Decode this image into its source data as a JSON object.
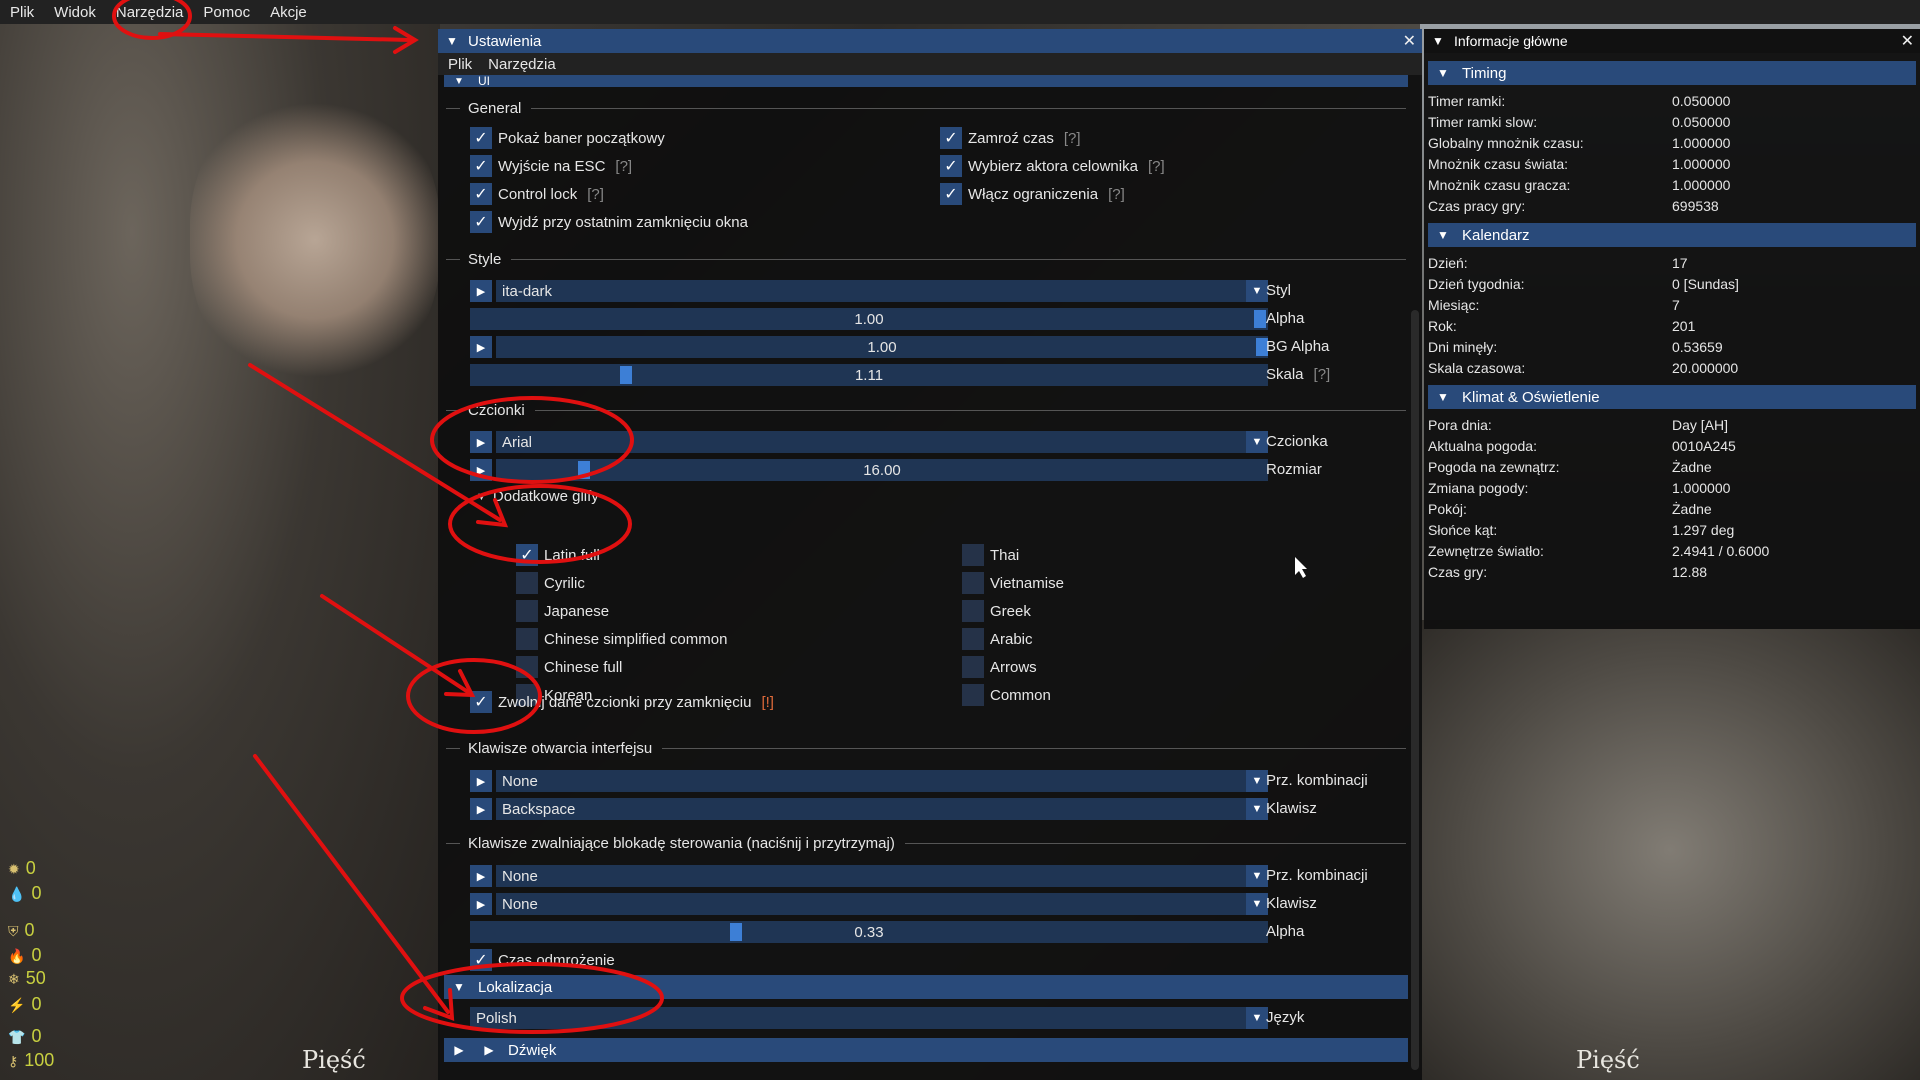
{
  "menubar": [
    "Plik",
    "Widok",
    "Narzędzia",
    "Pomoc",
    "Akcje"
  ],
  "settings": {
    "title": "Ustawienia",
    "submenu": [
      "Plik",
      "Narzędzia"
    ],
    "ui_label": "UI",
    "general": {
      "label": "General",
      "left": [
        "Pokaż baner początkowy",
        "Wyjście na ESC",
        "Control lock",
        "Wyjdź przy ostatnim zamknięciu okna"
      ],
      "right": [
        "Zamroź czas",
        "Wybierz aktora celownika",
        "Włącz ograniczenia"
      ],
      "help": "[?]"
    },
    "style": {
      "label": "Style",
      "theme": "ita-dark",
      "theme_label": "Styl",
      "alpha": "1.00",
      "alpha_label": "Alpha",
      "bg_alpha": "1.00",
      "bg_alpha_label": "BG Alpha",
      "scale": "1.11",
      "scale_label": "Skala",
      "alpha_fraction": 1.0,
      "bg_alpha_fraction": 1.0,
      "scale_fraction": 0.2
    },
    "fonts": {
      "label": "Czcionki",
      "font": "Arial",
      "font_label": "Czcionka",
      "size": "16.00",
      "size_label": "Rozmiar",
      "size_fraction": 0.12,
      "glyphs_label": "Dodatkowe glify",
      "glyphs_left": [
        {
          "name": "Latin full",
          "checked": true
        },
        {
          "name": "Cyrilic",
          "checked": false
        },
        {
          "name": "Japanese",
          "checked": false
        },
        {
          "name": "Chinese simplified common",
          "checked": false
        },
        {
          "name": "Chinese full",
          "checked": false
        },
        {
          "name": "Korean",
          "checked": false
        }
      ],
      "glyphs_right": [
        {
          "name": "Thai",
          "checked": false
        },
        {
          "name": "Vietnamise",
          "checked": false
        },
        {
          "name": "Greek",
          "checked": false
        },
        {
          "name": "Arabic",
          "checked": false
        },
        {
          "name": "Arrows",
          "checked": false
        },
        {
          "name": "Common",
          "checked": false
        }
      ],
      "release": "Zwolnij dane czcionki przy zamknięciu",
      "release_warn": "[!]"
    },
    "open_keys": {
      "label": "Klawisze otwarcia interfejsu",
      "combo": "None",
      "combo_label": "Prz. kombinacji",
      "key": "Backspace",
      "key_label": "Klawisz"
    },
    "release_keys": {
      "label": "Klawisze zwalniające blokadę sterowania (naciśnij i przytrzymaj)",
      "combo": "None",
      "combo_label": "Prz. kombinacji",
      "key": "None",
      "key_label": "Klawisz",
      "alpha": "0.33",
      "alpha_label": "Alpha",
      "alpha_fraction": 0.33,
      "unfreeze": "Czas odmrożenie"
    },
    "localization": {
      "label": "Lokalizacja",
      "lang": "Polish",
      "lang_label": "Język"
    },
    "sound": {
      "label": "Dźwięk"
    }
  },
  "info": {
    "title": "Informacje główne",
    "sections": [
      {
        "label": "Timing",
        "rows": [
          [
            "Timer ramki:",
            "0.050000"
          ],
          [
            "Timer ramki slow:",
            "0.050000"
          ],
          [
            "Globalny mnożnik czasu:",
            "1.000000"
          ],
          [
            "Mnożnik czasu świata:",
            "1.000000"
          ],
          [
            "Mnożnik czasu gracza:",
            "1.000000"
          ],
          [
            "Czas pracy gry:",
            "699538"
          ]
        ]
      },
      {
        "label": "Kalendarz",
        "rows": [
          [
            "Dzień:",
            "17"
          ],
          [
            "Dzień tygodnia:",
            "0 [Sundas]"
          ],
          [
            "Miesiąc:",
            "7"
          ],
          [
            "Rok:",
            "201"
          ],
          [
            "Dni minęły:",
            "0.53659"
          ],
          [
            "Skala czasowa:",
            "20.000000"
          ]
        ]
      },
      {
        "label": "Klimat & Oświetlenie",
        "rows": [
          [
            "Pora dnia:",
            "Day  [AH]"
          ],
          [
            "Aktualna pogoda:",
            "0010A245"
          ],
          [
            "Pogoda na zewnątrz:",
            "Żadne"
          ],
          [
            "Zmiana pogody:",
            "1.000000"
          ],
          [
            "Pokój:",
            "Żadne"
          ],
          [
            "Słońce kąt:",
            "1.297 deg"
          ],
          [
            "Zewnętrze światło:",
            "2.4941 / 0.6000"
          ],
          [
            "Czas gry:",
            "12.88"
          ]
        ]
      }
    ]
  },
  "hud": [
    "0",
    "0",
    "0",
    "0",
    "50",
    "0",
    "0",
    "100"
  ],
  "hud_bottom": "Pięść",
  "colors": {
    "accent": "#294a7a",
    "slider_bg": "#1f3554",
    "grab": "#3d7fd6",
    "annotation": "#e01010"
  }
}
